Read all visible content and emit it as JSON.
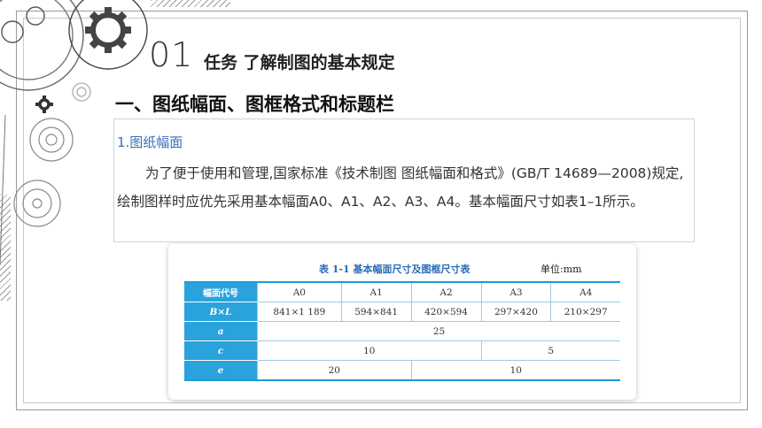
{
  "header": {
    "slide_number": "01",
    "task_title": "任务 了解制图的基本规定"
  },
  "section": {
    "title": "一、图纸幅面、图框格式和标题栏",
    "subheading": "1.图纸幅面",
    "paragraph": "为了便于使用和管理,国家标准《技术制图 图纸幅面和格式》(GB/T 14689—2008)规定,绘制图样时应优先采用基本幅面A0、A1、A2、A3、A4。基本幅面尺寸如表1–1所示。"
  },
  "table": {
    "caption": "表 1-1   基本幅面尺寸及图框尺寸表",
    "unit": "单位:mm",
    "row_headers": [
      "幅面代号",
      "B×L",
      "a",
      "c",
      "e"
    ],
    "sizes": [
      "A0",
      "A1",
      "A2",
      "A3",
      "A4"
    ],
    "dims": [
      "841×1 189",
      "594×841",
      "420×594",
      "297×420",
      "210×297"
    ],
    "a_value": "25",
    "c_values": [
      "10",
      "5"
    ],
    "e_values": [
      "20",
      "10"
    ]
  },
  "colors": {
    "accent_blue": "#2aa3dc",
    "subheading_blue": "#3b6fb6",
    "gear_gray": "#555555"
  }
}
